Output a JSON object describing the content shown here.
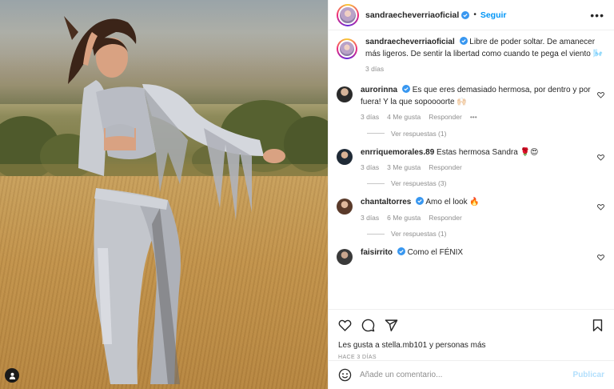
{
  "header": {
    "username": "sandraecheverriaoficial",
    "separator": "•",
    "follow_label": "Seguir",
    "more_icon": "more-dots-icon"
  },
  "caption": {
    "username": "sandraecheverriaoficial",
    "text": "Libre de poder soltar. De amanecer más ligeros. De sentir la libertad como cuando te pega el viento 🌬️",
    "time": "3 días"
  },
  "comments": [
    {
      "username": "aurorinna",
      "verified": true,
      "text": "Es que eres demasiado hermosa, por dentro y por fuera! Y la que sopoooorte 🙌🏻",
      "time": "3 días",
      "likes": "4 Me gusta",
      "reply": "Responder",
      "more": "•••",
      "view_replies": "Ver respuestas (1)"
    },
    {
      "username": "enrriquemorales.89",
      "verified": false,
      "text": "Estas hermosa Sandra 🌹😍",
      "time": "3 días",
      "likes": "3 Me gusta",
      "reply": "Responder",
      "view_replies": "Ver respuestas (3)"
    },
    {
      "username": "chantaltorres",
      "verified": true,
      "text": "Amo el look 🔥",
      "time": "3 días",
      "likes": "6 Me gusta",
      "reply": "Responder",
      "view_replies": "Ver respuestas (1)"
    },
    {
      "username": "faisirrito",
      "verified": true,
      "text": "Como el FÉNIX"
    }
  ],
  "likes_line": "Les gusta a stella.mb101 y personas más",
  "time_ago": "HACE 3 DÍAS",
  "add_comment": {
    "placeholder": "Añade un comentario...",
    "post_label": "Publicar"
  },
  "colors": {
    "accent": "#0095f6",
    "verified": "#3897f0",
    "post_disabled": "#b2dffc"
  }
}
